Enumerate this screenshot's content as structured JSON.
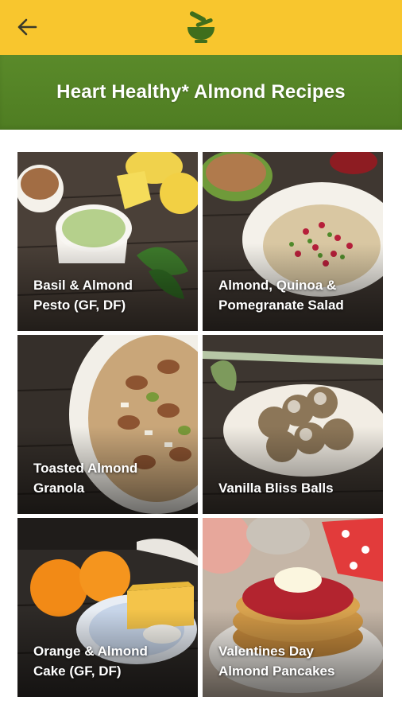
{
  "header": {
    "back_icon": "arrow-left-icon",
    "logo_icon": "mortar-pestle-icon",
    "background": "#f8c62e"
  },
  "banner": {
    "title": "Heart Healthy* Almond Recipes",
    "background": "#4f7d22"
  },
  "recipes": [
    {
      "label": "Basil & Almond\nPesto (GF, DF)"
    },
    {
      "label": "Almond, Quinoa &\nPomegranate Salad"
    },
    {
      "label": "Toasted Almond\nGranola"
    },
    {
      "label": "Vanilla Bliss Balls"
    },
    {
      "label": "Orange & Almond\nCake (GF, DF)"
    },
    {
      "label": "Valentines Day\nAlmond Pancakes"
    }
  ]
}
